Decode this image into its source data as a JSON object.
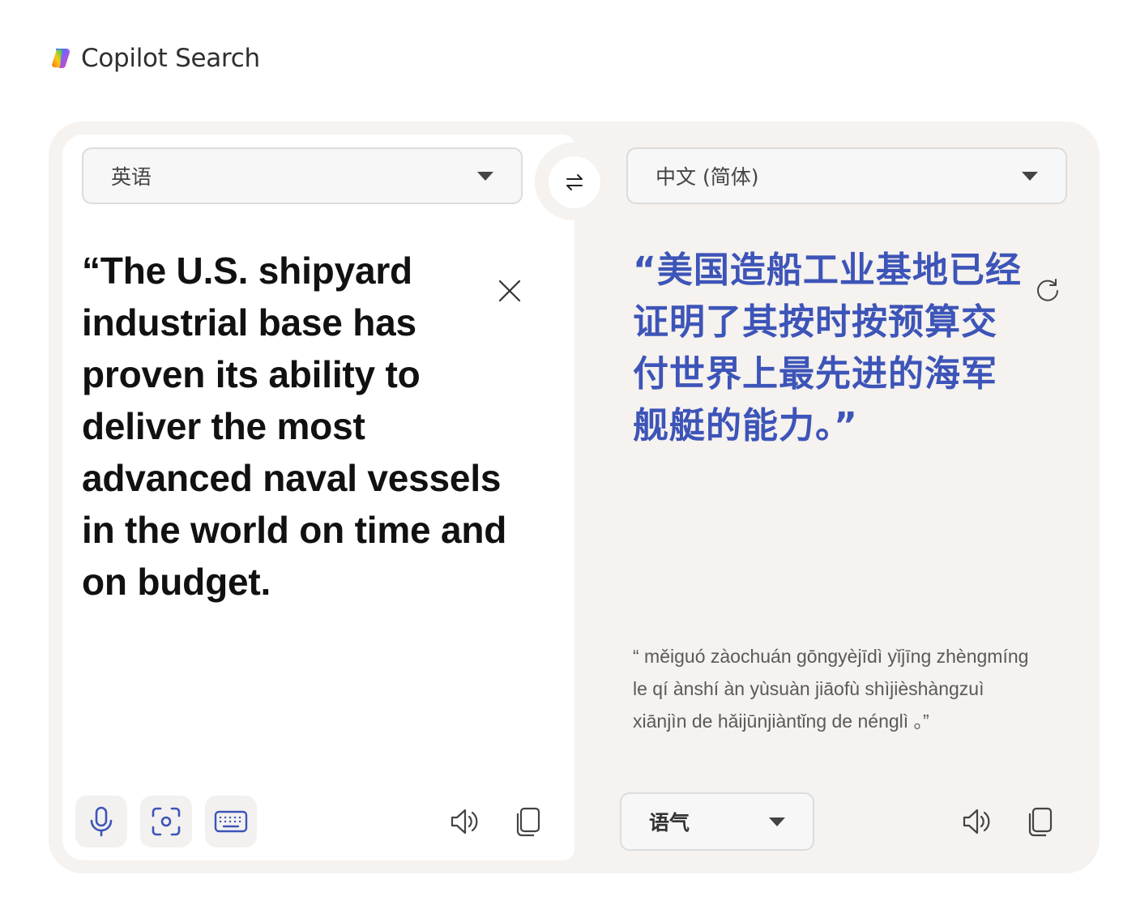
{
  "header": {
    "brand_title": "Copilot Search"
  },
  "translator": {
    "source_language": "英语",
    "target_language": "中文 (简体)",
    "source_text": "“The U.S. shipyard industrial base has proven its ability to deliver the most advanced naval vessels in the world on time and on budget.",
    "translated_text": "“美国造船工业基地已经证明了其按时按预算交付世界上最先进的海军舰艇的能力。”",
    "pinyin": "“ měiguó zàochuán gōngyèjīdì yǐjīng zhèngmíng le qí ànshí àn yùsuàn jiāofù shìjièshàngzuì xiānjìn de hǎijūnjiàntǐng de nénglì 。”",
    "tone_label": "语气"
  },
  "colors": {
    "card_background": "#f5f2ef",
    "translation_text": "#3d54b8",
    "tool_icon": "#3d54b8"
  },
  "icons": {
    "swap": "swap-arrows-icon",
    "clear": "close-icon",
    "refresh": "refresh-icon",
    "mic": "microphone-icon",
    "camera": "camera-scan-icon",
    "keyboard": "keyboard-icon",
    "speaker": "speaker-icon",
    "copy": "copy-icon"
  }
}
